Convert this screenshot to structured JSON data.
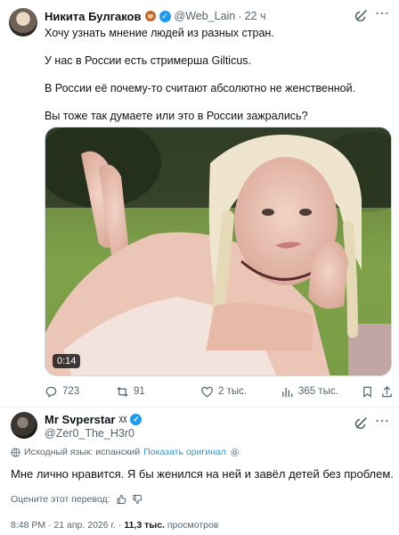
{
  "tweet": {
    "author_name": "Никита Булгаков",
    "author_handle": "@Web_Lain",
    "time": "22 ч",
    "paragraphs": [
      "Хочу узнать мнение людей из разных стран.",
      "У нас в России есть стримерша Gilticus.",
      "В России её почему-то считают абсолютно не женственной.",
      "Вы тоже так думаете или это в России зажрались?"
    ],
    "video_duration": "0:14",
    "stats": {
      "replies": "723",
      "reposts": "91",
      "likes": "2 тыс.",
      "views": "365 тыс."
    }
  },
  "reply": {
    "author_name": "Mr Svperstar",
    "author_suffix": "ᵡᵡ",
    "author_handle": "@Zer0_The_H3r0",
    "translation_note": "Исходный язык: испанский",
    "show_original": "Показать оригинал",
    "text": "Мне лично нравится. Я бы женился на ней и завёл детей без проблем.",
    "rate_translation": "Оцените этот перевод:",
    "timestamp": "8:48 PM · 21 апр. 2026 г. · ",
    "views_count": "11,3 тыс.",
    "views_label": " просмотров"
  },
  "icons": [
    "grok-icon",
    "more-icon",
    "verified-badge-icon",
    "reply-icon",
    "repost-icon",
    "like-icon",
    "views-icon",
    "bookmark-icon",
    "share-icon",
    "globe-icon",
    "gear-icon",
    "thumbs-up-icon",
    "thumbs-down-icon"
  ],
  "colors": {
    "accent": "#1d9bf0",
    "secondary_text": "#536471",
    "text": "#0f1419",
    "border": "#eff3f4"
  }
}
